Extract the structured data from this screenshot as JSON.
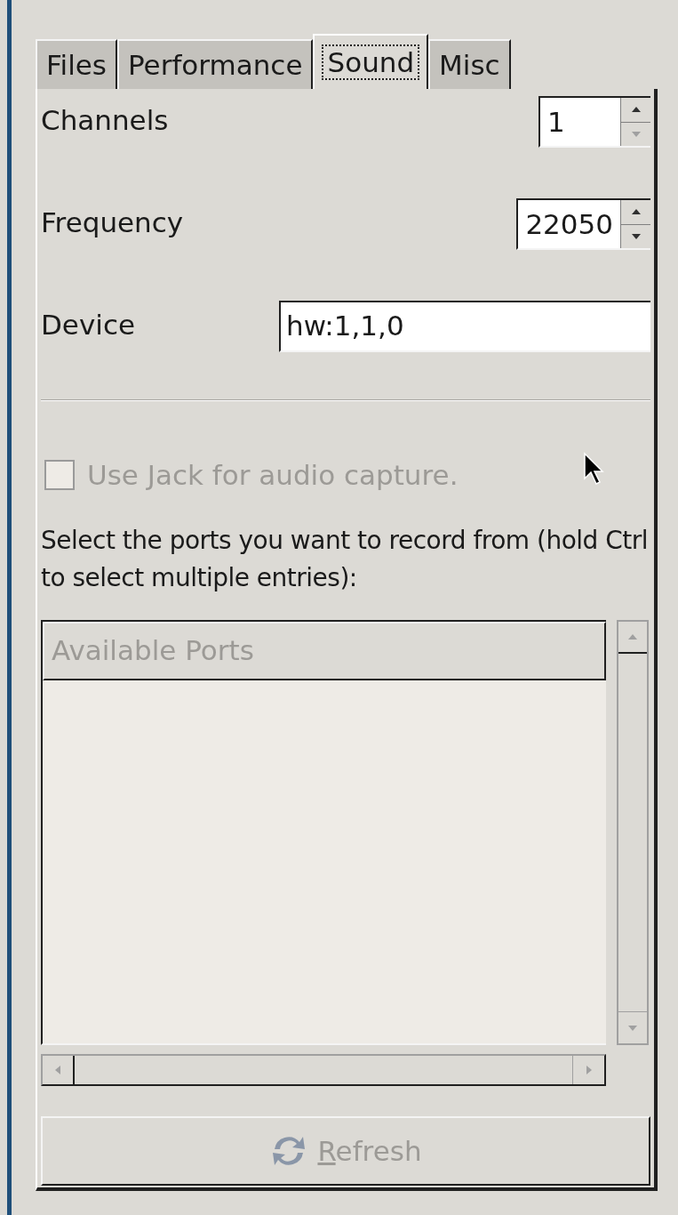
{
  "tabs": [
    {
      "label": "Files",
      "selected": false
    },
    {
      "label": "Performance",
      "selected": false
    },
    {
      "label": "Sound",
      "selected": true
    },
    {
      "label": "Misc",
      "selected": false
    }
  ],
  "settings": [
    {
      "kind": "spin",
      "label": "Channels",
      "value": "1",
      "down_disabled": true
    },
    {
      "kind": "spin",
      "label": "Frequency",
      "value": "22050",
      "down_disabled": false
    },
    {
      "kind": "text",
      "label": "Device",
      "value": "hw:1,1,0"
    }
  ],
  "jack_checkbox": {
    "label": "Use Jack for audio capture.",
    "checked": false,
    "disabled": true
  },
  "ports_hint": "Select the ports you want to record from (hold Ctrl to select multiple entries):",
  "ports_list": {
    "header": "Available Ports",
    "disabled": true
  },
  "refresh_button": {
    "label": "Refresh",
    "disabled": true
  }
}
